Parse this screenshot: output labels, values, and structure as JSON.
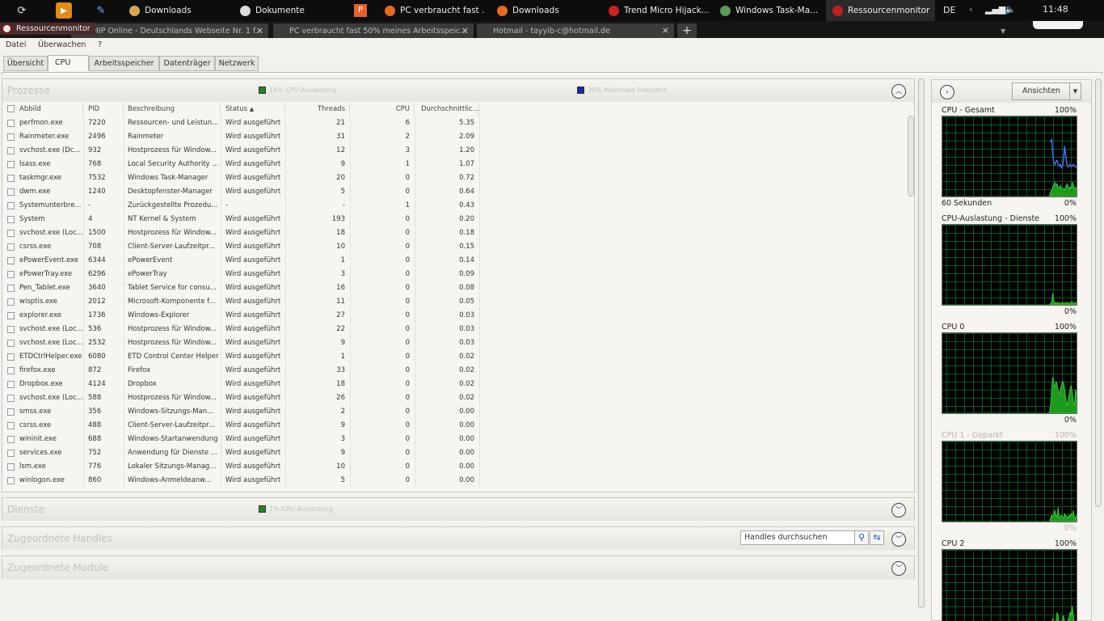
{
  "taskbar": {
    "tasks": [
      {
        "label": "Downloads",
        "color": "#d7a74b"
      },
      {
        "label": "Dokumente",
        "color": "#dddddd"
      },
      {
        "label": "PC verbraucht fast ...",
        "color": "#e86a1a"
      },
      {
        "label": "Downloads",
        "color": "#e86a1a"
      },
      {
        "label": "Trend Micro Hijack...",
        "color": "#d02020"
      },
      {
        "label": "Windows Task-Ma...",
        "color": "#5a9a5a"
      },
      {
        "label": "Ressourcenmonitor",
        "color": "#c02020"
      }
    ],
    "language": "DE",
    "time": "11:48"
  },
  "browser": {
    "window_title": "Ressourcenmonitor",
    "tabs": [
      {
        "label": "CHIP Online - Deutschlands Webseite Nr. 1 f..."
      },
      {
        "label": "PC verbraucht fast 50% meines Arbeitsspeic..."
      },
      {
        "label": "Hotmail - tayyib-c@hotmail.de"
      }
    ]
  },
  "menu": [
    "Datei",
    "Überwachen",
    "?"
  ],
  "tabs": [
    "Übersicht",
    "CPU",
    "Arbeitsspeicher",
    "Datenträger",
    "Netzwerk"
  ],
  "processes": {
    "title": "Prozesse",
    "cpu_usage": "14% CPU-Auslastung",
    "max_freq": "38% Maximale Frequenz",
    "cpu_color": "#1e8a1e",
    "freq_color": "#1a2a9a",
    "columns": [
      "Abbild",
      "PID",
      "Beschreibung",
      "Status",
      "Threads",
      "CPU",
      "Durchschnittlic..."
    ],
    "rows": [
      [
        "perfmon.exe",
        "7220",
        "Ressourcen- und Leistun...",
        "Wird ausgeführt",
        "21",
        "6",
        "5.35"
      ],
      [
        "Rainmeter.exe",
        "2496",
        "Rainmeter",
        "Wird ausgeführt",
        "31",
        "2",
        "2.09"
      ],
      [
        "svchost.exe (Dc...",
        "932",
        "Hostprozess für Window...",
        "Wird ausgeführt",
        "12",
        "3",
        "1.20"
      ],
      [
        "lsass.exe",
        "768",
        "Local Security Authority ...",
        "Wird ausgeführt",
        "9",
        "1",
        "1.07"
      ],
      [
        "taskmgr.exe",
        "7532",
        "Windows Task-Manager",
        "Wird ausgeführt",
        "20",
        "0",
        "0.72"
      ],
      [
        "dwm.exe",
        "1240",
        "Desktopfenster-Manager",
        "Wird ausgeführt",
        "5",
        "0",
        "0.64"
      ],
      [
        "Systemunterbre...",
        "-",
        "Zurückgestellte Prozedu...",
        "-",
        "-",
        "1",
        "0.43"
      ],
      [
        "System",
        "4",
        "NT Kernel & System",
        "Wird ausgeführt",
        "193",
        "0",
        "0.20"
      ],
      [
        "svchost.exe (Loc...",
        "1500",
        "Hostprozess für Window...",
        "Wird ausgeführt",
        "18",
        "0",
        "0.18"
      ],
      [
        "csrss.exe",
        "708",
        "Client-Server-Laufzeitpr...",
        "Wird ausgeführt",
        "10",
        "0",
        "0.15"
      ],
      [
        "ePowerEvent.exe",
        "6344",
        "ePowerEvent",
        "Wird ausgeführt",
        "1",
        "0",
        "0.14"
      ],
      [
        "ePowerTray.exe",
        "6296",
        "ePowerTray",
        "Wird ausgeführt",
        "3",
        "0",
        "0.09"
      ],
      [
        "Pen_Tablet.exe",
        "3640",
        "Tablet Service for consu...",
        "Wird ausgeführt",
        "16",
        "0",
        "0.08"
      ],
      [
        "wisptis.exe",
        "2012",
        "Microsoft-Komponente f...",
        "Wird ausgeführt",
        "11",
        "0",
        "0.05"
      ],
      [
        "explorer.exe",
        "1736",
        "Windows-Explorer",
        "Wird ausgeführt",
        "27",
        "0",
        "0.03"
      ],
      [
        "svchost.exe (Loc...",
        "536",
        "Hostprozess für Window...",
        "Wird ausgeführt",
        "22",
        "0",
        "0.03"
      ],
      [
        "svchost.exe (Loc...",
        "2532",
        "Hostprozess für Window...",
        "Wird ausgeführt",
        "9",
        "0",
        "0.03"
      ],
      [
        "ETDCtrlHelper.exe",
        "6080",
        "ETD Control Center Helper",
        "Wird ausgeführt",
        "1",
        "0",
        "0.02"
      ],
      [
        "firefox.exe",
        "872",
        "Firefox",
        "Wird ausgeführt",
        "33",
        "0",
        "0.02"
      ],
      [
        "Dropbox.exe",
        "4124",
        "Dropbox",
        "Wird ausgeführt",
        "18",
        "0",
        "0.02"
      ],
      [
        "svchost.exe (Loc...",
        "588",
        "Hostprozess für Window...",
        "Wird ausgeführt",
        "26",
        "0",
        "0.02"
      ],
      [
        "smss.exe",
        "356",
        "Windows-Sitzungs-Man...",
        "Wird ausgeführt",
        "2",
        "0",
        "0.00"
      ],
      [
        "csrss.exe",
        "488",
        "Client-Server-Laufzeitpr...",
        "Wird ausgeführt",
        "9",
        "0",
        "0.00"
      ],
      [
        "wininit.exe",
        "688",
        "Windows-Startanwendung",
        "Wird ausgeführt",
        "3",
        "0",
        "0.00"
      ],
      [
        "services.exe",
        "752",
        "Anwendung für Dienste ...",
        "Wird ausgeführt",
        "9",
        "0",
        "0.00"
      ],
      [
        "lsm.exe",
        "776",
        "Lokaler Sitzungs-Manag...",
        "Wird ausgeführt",
        "10",
        "0",
        "0.00"
      ],
      [
        "winlogon.exe",
        "860",
        "Windows-Anmeldeanw...",
        "Wird ausgeführt",
        "5",
        "0",
        "0.00"
      ]
    ]
  },
  "services": {
    "title": "Dienste",
    "cpu_usage": "1% CPU-Auslastung"
  },
  "handles": {
    "title": "Zugeordnete Handles",
    "search_placeholder": "Handles durchsuchen"
  },
  "modules": {
    "title": "Zugeordnete Module"
  },
  "right": {
    "views_button": "Ansichten",
    "graphs": [
      {
        "label": "CPU - Gesamt",
        "max": "100%",
        "min": "0%",
        "footer": "60 Sekunden",
        "dim": false,
        "green": [
          0,
          0,
          0,
          0,
          0,
          0,
          0,
          0,
          0,
          0,
          0,
          0,
          0,
          0,
          0,
          0,
          0,
          0,
          0,
          0,
          0,
          0,
          0,
          0,
          0,
          0,
          0,
          0,
          0,
          0,
          0,
          0,
          0,
          0,
          0,
          0,
          0,
          0,
          0,
          0,
          0,
          0,
          0,
          0,
          0,
          0,
          0,
          0,
          0,
          0,
          0,
          0,
          0,
          0,
          0,
          0,
          0,
          0,
          0,
          0,
          0,
          0,
          0,
          0,
          0,
          0,
          0,
          0,
          0,
          0,
          0,
          0,
          0,
          0,
          0,
          0,
          0,
          0,
          0,
          0,
          0,
          0,
          0,
          0,
          0,
          0,
          0,
          0,
          0,
          0,
          0,
          0,
          0,
          0,
          0,
          0,
          0,
          0,
          0,
          0,
          6,
          8,
          12,
          15,
          18,
          14,
          16,
          12,
          10,
          14,
          11,
          9,
          10,
          8,
          12,
          16,
          14,
          9,
          12,
          10,
          18,
          15,
          11,
          10,
          12
        ],
        "blue": [
          null,
          null,
          null,
          null,
          null,
          null,
          null,
          null,
          null,
          null,
          null,
          null,
          null,
          null,
          null,
          null,
          null,
          null,
          null,
          null,
          null,
          null,
          null,
          null,
          null,
          null,
          null,
          null,
          null,
          null,
          null,
          null,
          null,
          null,
          null,
          null,
          null,
          null,
          null,
          null,
          null,
          null,
          null,
          null,
          null,
          null,
          null,
          null,
          null,
          null,
          null,
          null,
          null,
          null,
          null,
          null,
          null,
          null,
          null,
          null,
          null,
          null,
          null,
          null,
          null,
          null,
          null,
          null,
          null,
          null,
          null,
          null,
          null,
          null,
          null,
          null,
          null,
          null,
          null,
          null,
          null,
          null,
          null,
          null,
          null,
          null,
          null,
          null,
          null,
          null,
          null,
          null,
          null,
          null,
          null,
          null,
          null,
          null,
          null,
          null,
          68,
          72,
          54,
          42,
          40,
          44,
          45,
          40,
          38,
          40,
          36,
          38,
          44,
          63,
          52,
          40,
          37,
          38,
          40,
          37,
          38,
          40,
          38,
          37,
          36
        ]
      },
      {
        "label": "CPU-Auslastung - Dienste",
        "max": "100%",
        "min": "0%",
        "footer": "",
        "dim": false,
        "green": [
          0,
          0,
          0,
          0,
          0,
          0,
          0,
          0,
          0,
          0,
          0,
          0,
          0,
          0,
          0,
          0,
          0,
          0,
          0,
          0,
          0,
          0,
          0,
          0,
          0,
          0,
          0,
          0,
          0,
          0,
          0,
          0,
          0,
          0,
          0,
          0,
          0,
          0,
          0,
          0,
          0,
          0,
          0,
          0,
          0,
          0,
          0,
          0,
          0,
          0,
          0,
          0,
          0,
          0,
          0,
          0,
          0,
          0,
          0,
          0,
          0,
          0,
          0,
          0,
          0,
          0,
          0,
          0,
          0,
          0,
          0,
          0,
          0,
          0,
          0,
          0,
          0,
          0,
          0,
          0,
          0,
          0,
          0,
          0,
          0,
          0,
          0,
          0,
          0,
          0,
          0,
          0,
          0,
          0,
          0,
          0,
          0,
          0,
          0,
          0,
          2,
          3,
          14,
          4,
          2,
          3,
          2,
          3,
          2,
          2,
          2,
          3,
          2,
          2,
          3,
          2,
          3,
          2,
          2,
          3,
          4,
          2,
          2,
          3,
          2
        ],
        "blue": []
      },
      {
        "label": "CPU 0",
        "max": "100%",
        "min": "0%",
        "footer": "",
        "dim": false,
        "green": [
          0,
          0,
          0,
          0,
          0,
          0,
          0,
          0,
          0,
          0,
          0,
          0,
          0,
          0,
          0,
          0,
          0,
          0,
          0,
          0,
          0,
          0,
          0,
          0,
          0,
          0,
          0,
          0,
          0,
          0,
          0,
          0,
          0,
          0,
          0,
          0,
          0,
          0,
          0,
          0,
          0,
          0,
          0,
          0,
          0,
          0,
          0,
          0,
          0,
          0,
          0,
          0,
          0,
          0,
          0,
          0,
          0,
          0,
          0,
          0,
          0,
          0,
          0,
          0,
          0,
          0,
          0,
          0,
          0,
          0,
          0,
          0,
          0,
          0,
          0,
          0,
          0,
          0,
          0,
          0,
          0,
          0,
          0,
          0,
          0,
          0,
          0,
          0,
          0,
          0,
          0,
          0,
          0,
          0,
          0,
          0,
          0,
          0,
          0,
          0,
          10,
          30,
          45,
          38,
          32,
          40,
          36,
          28,
          24,
          30,
          34,
          40,
          38,
          30,
          20,
          10,
          14,
          22,
          30,
          35,
          28,
          14,
          10,
          30,
          22
        ],
        "blue": []
      },
      {
        "label": "CPU 1 - Geparkt",
        "max": "100%",
        "min": "0%",
        "footer": "",
        "dim": true,
        "green": [
          0,
          0,
          0,
          0,
          0,
          0,
          0,
          0,
          0,
          0,
          0,
          0,
          0,
          0,
          0,
          0,
          0,
          0,
          0,
          0,
          0,
          0,
          0,
          0,
          0,
          0,
          0,
          0,
          0,
          0,
          0,
          0,
          0,
          0,
          0,
          0,
          0,
          0,
          0,
          0,
          0,
          0,
          0,
          0,
          0,
          0,
          0,
          0,
          0,
          0,
          0,
          0,
          0,
          0,
          0,
          0,
          0,
          0,
          0,
          0,
          0,
          0,
          0,
          0,
          0,
          0,
          0,
          0,
          0,
          0,
          0,
          0,
          0,
          0,
          0,
          0,
          0,
          0,
          0,
          0,
          0,
          0,
          0,
          0,
          0,
          0,
          0,
          0,
          0,
          0,
          0,
          0,
          0,
          0,
          0,
          0,
          0,
          0,
          0,
          0,
          4,
          8,
          6,
          10,
          14,
          8,
          6,
          18,
          4,
          6,
          8,
          6,
          4,
          10,
          8,
          6,
          4,
          8,
          6,
          10,
          8,
          14,
          6,
          4,
          8
        ],
        "blue": []
      },
      {
        "label": "CPU 2",
        "max": "100%",
        "min": "",
        "footer": "",
        "dim": false,
        "green": [
          0,
          0,
          0,
          0,
          0,
          0,
          0,
          0,
          0,
          0,
          0,
          0,
          0,
          0,
          0,
          0,
          0,
          0,
          0,
          0,
          0,
          0,
          0,
          0,
          0,
          0,
          0,
          0,
          0,
          0,
          0,
          0,
          0,
          0,
          0,
          0,
          0,
          0,
          0,
          0,
          0,
          0,
          0,
          0,
          0,
          0,
          0,
          0,
          0,
          0,
          0,
          0,
          0,
          0,
          0,
          0,
          0,
          0,
          0,
          0,
          0,
          0,
          0,
          0,
          0,
          0,
          0,
          0,
          0,
          0,
          0,
          0,
          0,
          0,
          0,
          0,
          0,
          0,
          0,
          0,
          0,
          0,
          0,
          0,
          0,
          0,
          0,
          0,
          0,
          0,
          0,
          0,
          0,
          0,
          0,
          0,
          0,
          0,
          0,
          0,
          4,
          10,
          14,
          8,
          6,
          10,
          22,
          18,
          8,
          6,
          10,
          14,
          18,
          10,
          6,
          8,
          12,
          16,
          22,
          18,
          30,
          20,
          10,
          8,
          12
        ],
        "blue": []
      }
    ]
  }
}
